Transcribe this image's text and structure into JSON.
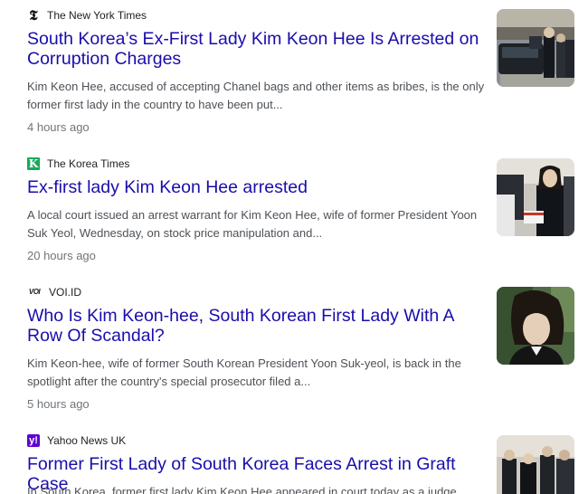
{
  "articles": [
    {
      "source": "The New York Times",
      "source_icon": "nyt-logo-icon",
      "headline": "South Korea’s Ex-First Lady Kim Keon Hee Is Arrested on Corruption Charges",
      "snippet": "Kim Keon Hee, accused of accepting Chanel bags and other items as bribes, is the only former first lady in the country to have been put...",
      "time": "4 hours ago"
    },
    {
      "source": "The Korea Times",
      "source_icon": "korea-times-logo-icon",
      "headline": "Ex-first lady Kim Keon Hee arrested",
      "snippet": "A local court issued an arrest warrant for Kim Keon Hee, wife of former President Yoon Suk Yeol, Wednesday, on stock price manipulation and...",
      "time": "20 hours ago"
    },
    {
      "source": "VOI.ID",
      "source_icon": "voi-logo-icon",
      "headline": "Who Is Kim Keon-hee, South Korean First Lady With A Row Of Scandal?",
      "snippet": "Kim Keon-hee, wife of former South Korean President Yoon Suk-yeol, is back in the spotlight after the country's special prosecutor filed a...",
      "time": "5 hours ago"
    },
    {
      "source": "Yahoo News UK",
      "source_icon": "yahoo-logo-icon",
      "headline": "Former First Lady of South Korea Faces Arrest in Graft Case",
      "snippet": "In South Korea, former first lady Kim Keon Hee appeared in court today as a judge",
      "time": ""
    }
  ],
  "logos": {
    "nyt": "𝕿",
    "korea_times": "K",
    "voi": "VOI",
    "yahoo": "y!"
  },
  "colors": {
    "headline": "#1a0dab",
    "snippet": "#4d5156",
    "time": "#70757a",
    "korea_times_green": "#18a85a",
    "yahoo_purple": "#6001d2"
  }
}
